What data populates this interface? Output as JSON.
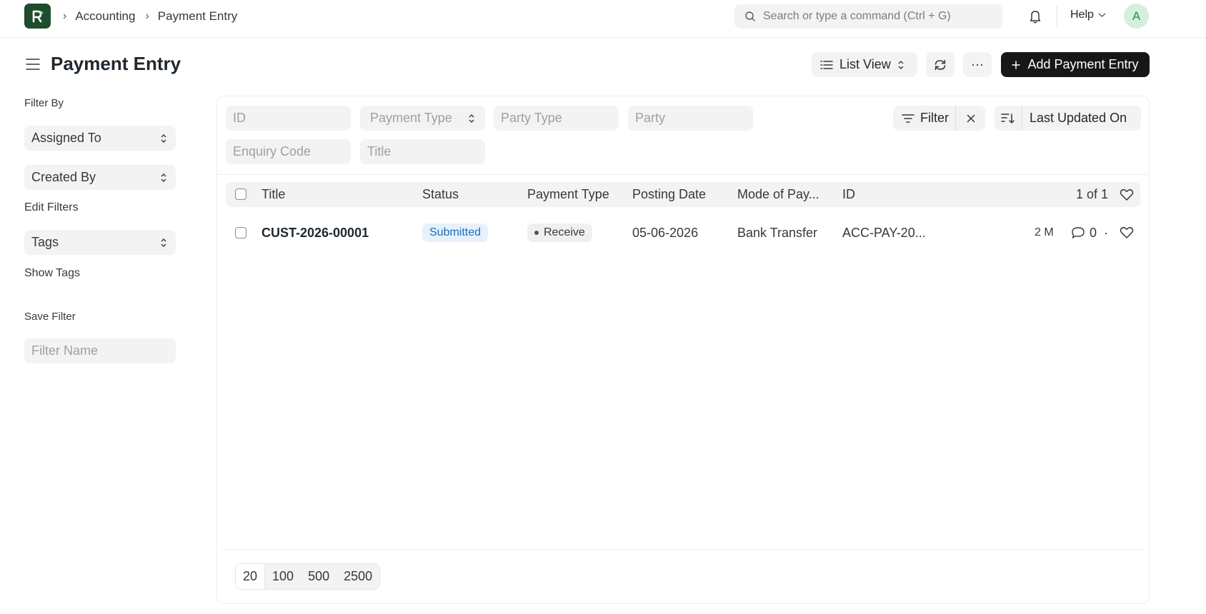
{
  "navbar": {
    "breadcrumbs": [
      "Accounting",
      "Payment Entry"
    ],
    "search_placeholder": "Search or type a command (Ctrl + G)",
    "help_label": "Help",
    "avatar_letter": "A"
  },
  "page": {
    "title": "Payment Entry",
    "list_view_label": "List View",
    "more_label": "···",
    "add_button_label": "Add Payment Entry"
  },
  "sidebar": {
    "filter_by_label": "Filter By",
    "assigned_to_label": "Assigned To",
    "created_by_label": "Created By",
    "edit_filters_label": "Edit Filters",
    "tags_label": "Tags",
    "show_tags_label": "Show Tags",
    "save_filter_label": "Save Filter",
    "filter_name_placeholder": "Filter Name"
  },
  "filters": {
    "id_placeholder": "ID",
    "payment_type_label": "Payment Type",
    "party_type_placeholder": "Party Type",
    "party_placeholder": "Party",
    "enquiry_code_placeholder": "Enquiry Code",
    "title_placeholder": "Title",
    "filter_label": "Filter",
    "sort_label": "Last Updated On"
  },
  "table": {
    "columns": [
      "Title",
      "Status",
      "Payment Type",
      "Posting Date",
      "Mode of Pay...",
      "ID"
    ],
    "count_label": "1 of 1",
    "rows": [
      {
        "title": "CUST-2026-00001",
        "status": "Submitted",
        "payment_type": "Receive",
        "posting_date": "05-06-2026",
        "mode_of_payment": "Bank Transfer",
        "id": "ACC-PAY-20...",
        "modified": "2 M",
        "comments": "0",
        "separator": "·"
      }
    ]
  },
  "pagination": {
    "sizes": [
      "20",
      "100",
      "500",
      "2500"
    ]
  },
  "colors": {
    "primary_button": "#171717",
    "logo_bg": "#1e4d2e",
    "status_submitted": "#1a6fb8",
    "avatar_bg": "#d4f0dd"
  }
}
